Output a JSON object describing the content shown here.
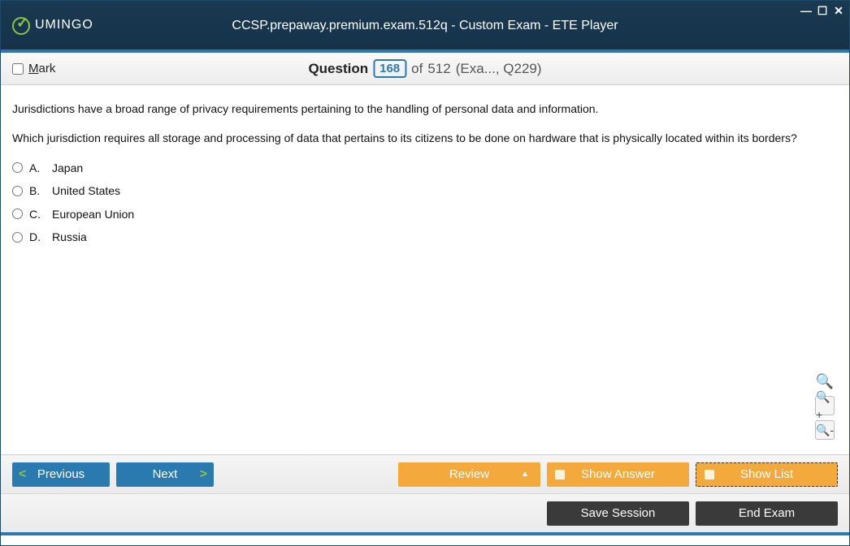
{
  "header": {
    "logo_text": "UMINGO",
    "app_title": "CCSP.prepaway.premium.exam.512q - Custom Exam - ETE Player"
  },
  "question_bar": {
    "mark_label": "Mark",
    "question_word": "Question",
    "current": "168",
    "of_word": "of",
    "total": "512",
    "meta": "(Exa..., Q229)"
  },
  "question": {
    "context": "Jurisdictions have a broad range of privacy requirements pertaining to the handling of personal data and information.",
    "prompt": "Which jurisdiction requires all storage and processing of data that pertains to its citizens to be done on hardware that is physically located within its borders?",
    "options": [
      {
        "letter": "A.",
        "text": "Japan"
      },
      {
        "letter": "B.",
        "text": "United States"
      },
      {
        "letter": "C.",
        "text": "European Union"
      },
      {
        "letter": "D.",
        "text": "Russia"
      }
    ]
  },
  "buttons": {
    "previous": "Previous",
    "next": "Next",
    "review": "Review",
    "show_answer": "Show Answer",
    "show_list": "Show List",
    "save_session": "Save Session",
    "end_exam": "End Exam"
  }
}
